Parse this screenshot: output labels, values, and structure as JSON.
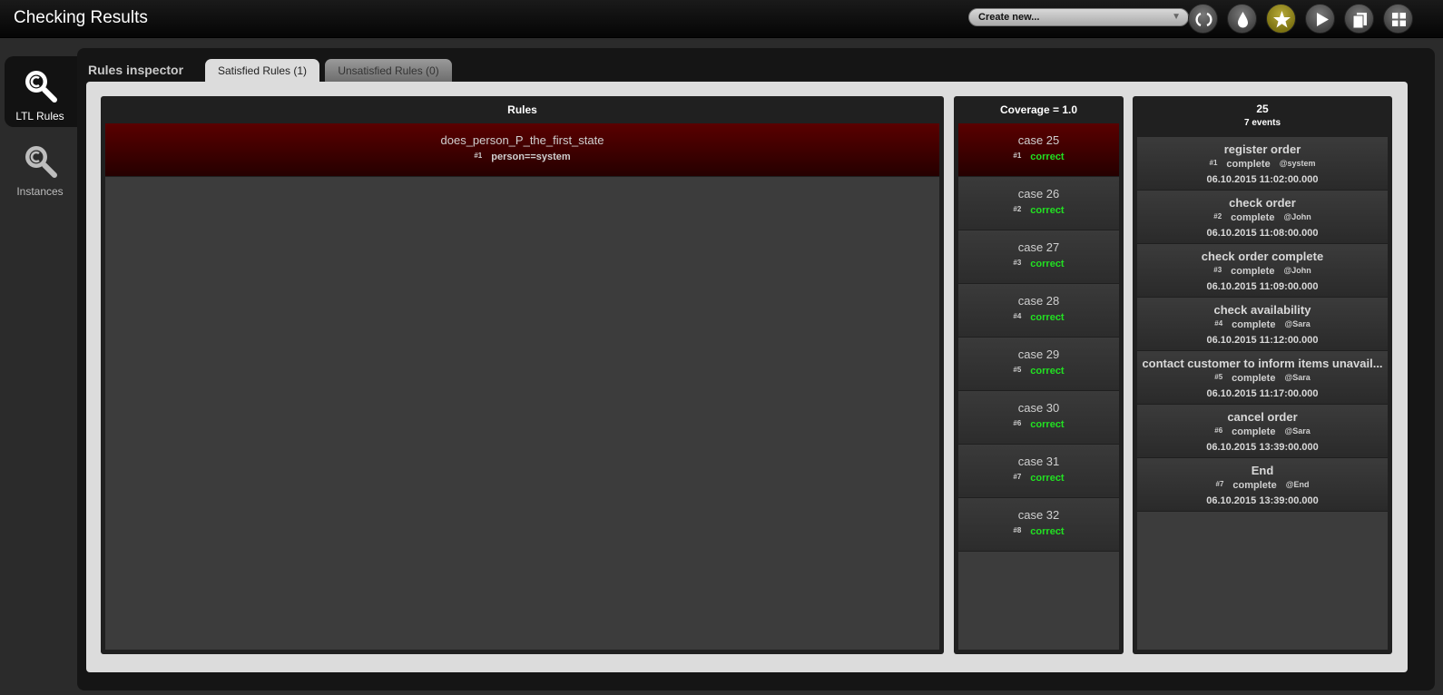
{
  "app": {
    "title": "Checking Results"
  },
  "toolbar": {
    "create_select": "Create new...",
    "buttons": [
      "sync-icon",
      "drop-icon",
      "star-icon",
      "play-icon",
      "copy-icon",
      "grid-icon"
    ]
  },
  "sidebar": {
    "items": [
      {
        "label": "LTL Rules",
        "icon": "search-icon",
        "active": true
      },
      {
        "label": "Instances",
        "icon": "search-icon",
        "active": false
      }
    ]
  },
  "inspector": {
    "label": "Rules inspector",
    "tabs": [
      {
        "label": "Satisfied Rules (1)",
        "selected": true
      },
      {
        "label": "Unsatisfied Rules (0)",
        "selected": false
      }
    ]
  },
  "rules": {
    "header": "Rules",
    "items": [
      {
        "name": "does_person_P_the_first_state",
        "num": "#1",
        "expr": "person==system"
      }
    ]
  },
  "coverage": {
    "header": "Coverage = 1.0",
    "items": [
      {
        "case": "case 25",
        "num": "#1",
        "status": "correct"
      },
      {
        "case": "case 26",
        "num": "#2",
        "status": "correct"
      },
      {
        "case": "case 27",
        "num": "#3",
        "status": "correct"
      },
      {
        "case": "case 28",
        "num": "#4",
        "status": "correct"
      },
      {
        "case": "case 29",
        "num": "#5",
        "status": "correct"
      },
      {
        "case": "case 30",
        "num": "#6",
        "status": "correct"
      },
      {
        "case": "case 31",
        "num": "#7",
        "status": "correct"
      },
      {
        "case": "case 32",
        "num": "#8",
        "status": "correct"
      }
    ]
  },
  "events": {
    "header": "25",
    "subheader": "7 events",
    "items": [
      {
        "name": "register order",
        "num": "#1",
        "lifecycle": "complete",
        "who": "@system",
        "time": "06.10.2015 11:02:00.000"
      },
      {
        "name": "check order",
        "num": "#2",
        "lifecycle": "complete",
        "who": "@John",
        "time": "06.10.2015 11:08:00.000"
      },
      {
        "name": "check order complete",
        "num": "#3",
        "lifecycle": "complete",
        "who": "@John",
        "time": "06.10.2015 11:09:00.000"
      },
      {
        "name": "check availability",
        "num": "#4",
        "lifecycle": "complete",
        "who": "@Sara",
        "time": "06.10.2015 11:12:00.000"
      },
      {
        "name": "contact customer to inform items unavail...",
        "num": "#5",
        "lifecycle": "complete",
        "who": "@Sara",
        "time": "06.10.2015 11:17:00.000"
      },
      {
        "name": "cancel order",
        "num": "#6",
        "lifecycle": "complete",
        "who": "@Sara",
        "time": "06.10.2015 13:39:00.000"
      },
      {
        "name": "End",
        "num": "#7",
        "lifecycle": "complete",
        "who": "@End",
        "time": "06.10.2015 13:39:00.000"
      }
    ]
  },
  "colors": {
    "selected_row": "#5a0000",
    "correct": "#22e022",
    "active_star": "#7d7312"
  }
}
